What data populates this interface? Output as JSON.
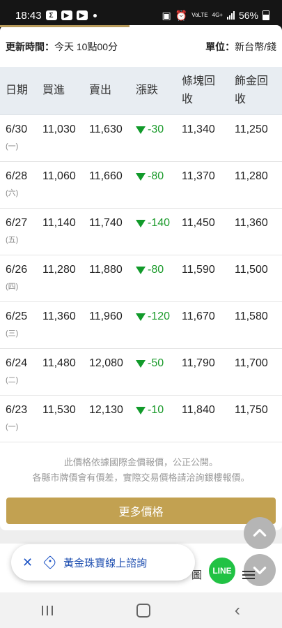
{
  "status_bar": {
    "time": "18:43",
    "notification_icons": [
      "sigma-icon",
      "youtube-icon",
      "youtube-icon"
    ],
    "network": "4G+",
    "volte": "VoLTE",
    "battery": "56%"
  },
  "header": {
    "update_label": "更新時間：",
    "update_value": "今天 10點00分",
    "unit_label": "單位：",
    "unit_value": "新台幣/錢"
  },
  "table": {
    "columns": [
      "日期",
      "買進",
      "賣出",
      "漲跌",
      "條塊回收",
      "飾金回收"
    ],
    "rows": [
      {
        "date": "6/30",
        "weekday": "(一)",
        "buy": "11,030",
        "sell": "11,630",
        "change": "-30",
        "bar": "11,340",
        "jewelry": "11,250"
      },
      {
        "date": "6/28",
        "weekday": "(六)",
        "buy": "11,060",
        "sell": "11,660",
        "change": "-80",
        "bar": "11,370",
        "jewelry": "11,280"
      },
      {
        "date": "6/27",
        "weekday": "(五)",
        "buy": "11,140",
        "sell": "11,740",
        "change": "-140",
        "bar": "11,450",
        "jewelry": "11,360"
      },
      {
        "date": "6/26",
        "weekday": "(四)",
        "buy": "11,280",
        "sell": "11,880",
        "change": "-80",
        "bar": "11,590",
        "jewelry": "11,500"
      },
      {
        "date": "6/25",
        "weekday": "(三)",
        "buy": "11,360",
        "sell": "11,960",
        "change": "-120",
        "bar": "11,670",
        "jewelry": "11,580"
      },
      {
        "date": "6/24",
        "weekday": "(二)",
        "buy": "11,480",
        "sell": "12,080",
        "change": "-50",
        "bar": "11,790",
        "jewelry": "11,700"
      },
      {
        "date": "6/23",
        "weekday": "(一)",
        "buy": "11,530",
        "sell": "12,130",
        "change": "-10",
        "bar": "11,840",
        "jewelry": "11,750"
      }
    ]
  },
  "note": {
    "line1": "此價格依據國際金價報價，公正公開。",
    "line2": "各縣市牌價會有價差，實際交易價格請洽詢銀樓報價。"
  },
  "more_button": "更多價格",
  "consult_chip": {
    "label": "黃金珠寶線上諮詢"
  },
  "partial_text": "圖",
  "line_badge": "LINE",
  "colors": {
    "gold": "#c2a151",
    "down_green": "#1a9a2a",
    "header_bg": "#e8edf2",
    "chip_blue": "#1f4fb0"
  }
}
